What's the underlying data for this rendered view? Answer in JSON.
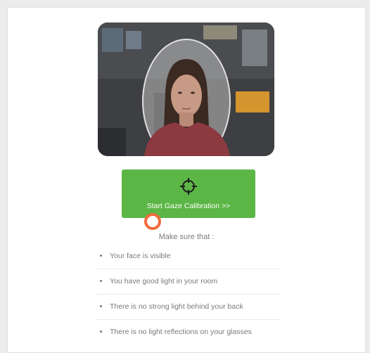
{
  "calibration": {
    "start_button_label": "Start Gaze Calibration >>",
    "start_button_icon": "crosshair-icon",
    "accent_color": "#5cb646",
    "cursor_marker_color": "#f26b3a"
  },
  "instructions": {
    "title": "Make sure that :",
    "items": [
      "Your face is visible",
      "You have good light in your room",
      "There is no strong light behind your back",
      "There is no light reflections on your glasses"
    ]
  }
}
